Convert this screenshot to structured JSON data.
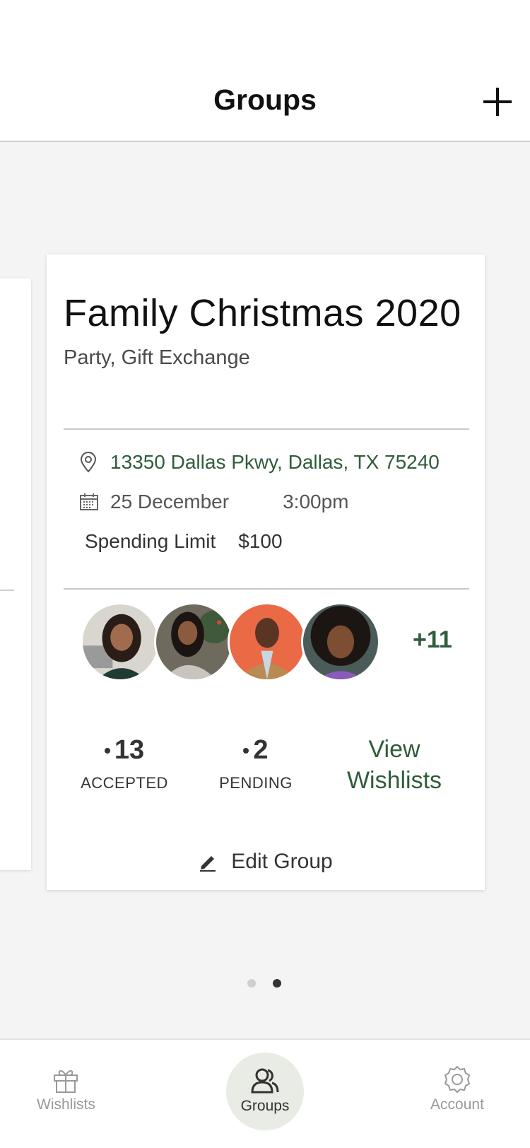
{
  "header": {
    "title": "Groups"
  },
  "group_card": {
    "title": "Family Christmas 2020",
    "subtitle": "Party, Gift Exchange",
    "address": "13350 Dallas Pkwy, Dallas, TX 75240",
    "date": "25 December",
    "time": "3:00pm",
    "spending_limit_label": "Spending Limit",
    "spending_limit_value": "$100",
    "more_members": "+11",
    "accepted_count": "13",
    "accepted_label": "ACCEPTED",
    "pending_count": "2",
    "pending_label": "PENDING",
    "view_wishlists_line1": "View",
    "view_wishlists_line2": "Wishlists",
    "edit_label": "Edit Group"
  },
  "pager": {
    "total": 2,
    "active_index": 1
  },
  "tabbar": {
    "items": [
      {
        "label": "Wishlists",
        "icon": "gift-icon"
      },
      {
        "label": "Groups",
        "icon": "people-icon"
      },
      {
        "label": "Account",
        "icon": "gear-icon"
      }
    ],
    "active": "Groups"
  },
  "colors": {
    "accent_green": "#2f5d3a",
    "background": "#f4f4f4",
    "tab_active_bg": "#e9ebe5"
  }
}
